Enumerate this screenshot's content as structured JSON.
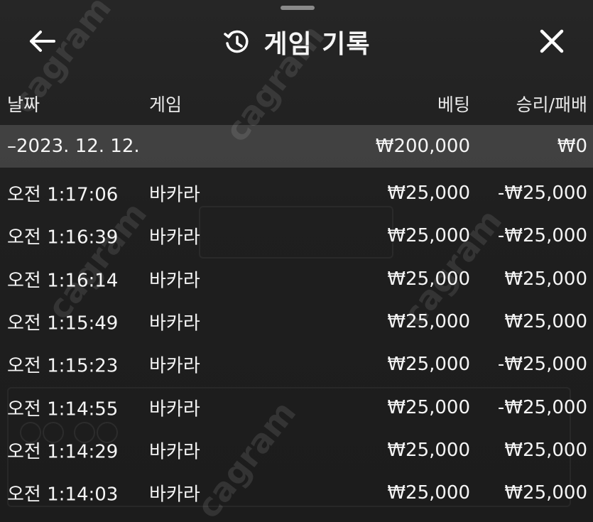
{
  "header": {
    "title": "게임 기록",
    "back_icon": "arrow-left-icon",
    "history_icon": "history-icon",
    "close_icon": "close-icon"
  },
  "columns": {
    "date": "날짜",
    "game": "게임",
    "bet": "베팅",
    "result": "승리/패배"
  },
  "group": {
    "date": "–2023. 12. 12.",
    "bet": "₩200,000",
    "result": "₩0"
  },
  "rows": [
    {
      "time": "오전 1:17:06",
      "game": "바카라",
      "bet": "₩25,000",
      "result": "-₩25,000"
    },
    {
      "time": "오전 1:16:39",
      "game": "바카라",
      "bet": "₩25,000",
      "result": "-₩25,000"
    },
    {
      "time": "오전 1:16:14",
      "game": "바카라",
      "bet": "₩25,000",
      "result": "₩25,000"
    },
    {
      "time": "오전 1:15:49",
      "game": "바카라",
      "bet": "₩25,000",
      "result": "₩25,000"
    },
    {
      "time": "오전 1:15:23",
      "game": "바카라",
      "bet": "₩25,000",
      "result": "-₩25,000"
    },
    {
      "time": "오전 1:14:55",
      "game": "바카라",
      "bet": "₩25,000",
      "result": "-₩25,000"
    },
    {
      "time": "오전 1:14:29",
      "game": "바카라",
      "bet": "₩25,000",
      "result": "₩25,000"
    },
    {
      "time": "오전 1:14:03",
      "game": "바카라",
      "bet": "₩25,000",
      "result": "₩25,000"
    }
  ],
  "watermark": "cagram",
  "colors": {
    "background": "#1b1b1b",
    "group_row": "#464646",
    "text": "#f5f5f5"
  }
}
